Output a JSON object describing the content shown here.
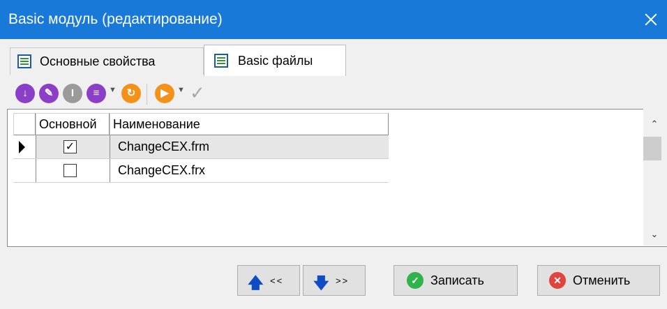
{
  "window": {
    "title": "Basic модуль (редактирование)"
  },
  "tabs": [
    {
      "label": "Основные свойства"
    },
    {
      "label": "Basic файлы"
    }
  ],
  "grid": {
    "columns": [
      "Основной",
      "Наименование"
    ],
    "rows": [
      {
        "name": "ChangeCEX.frm",
        "main": true,
        "selected": true
      },
      {
        "name": "ChangeCEX.frx",
        "main": false,
        "selected": false
      }
    ]
  },
  "footer": {
    "up_label": "<<",
    "down_label": ">>",
    "save_label": "Записать",
    "cancel_label": "Отменить"
  },
  "colors": {
    "titlebar": "#1879d8",
    "toolbar_purple": "#8b3fc8",
    "toolbar_orange": "#f49119",
    "save_green": "#2fb34a",
    "cancel_red": "#e0443a",
    "arrow_blue": "#0f4cc4"
  },
  "icons": {
    "toolbar": [
      "add-icon",
      "edit-icon",
      "delete-icon",
      "list-icon",
      "refresh-icon",
      "run-icon",
      "check-icon"
    ],
    "save": "check-circle-icon",
    "cancel": "close-circle-icon"
  }
}
